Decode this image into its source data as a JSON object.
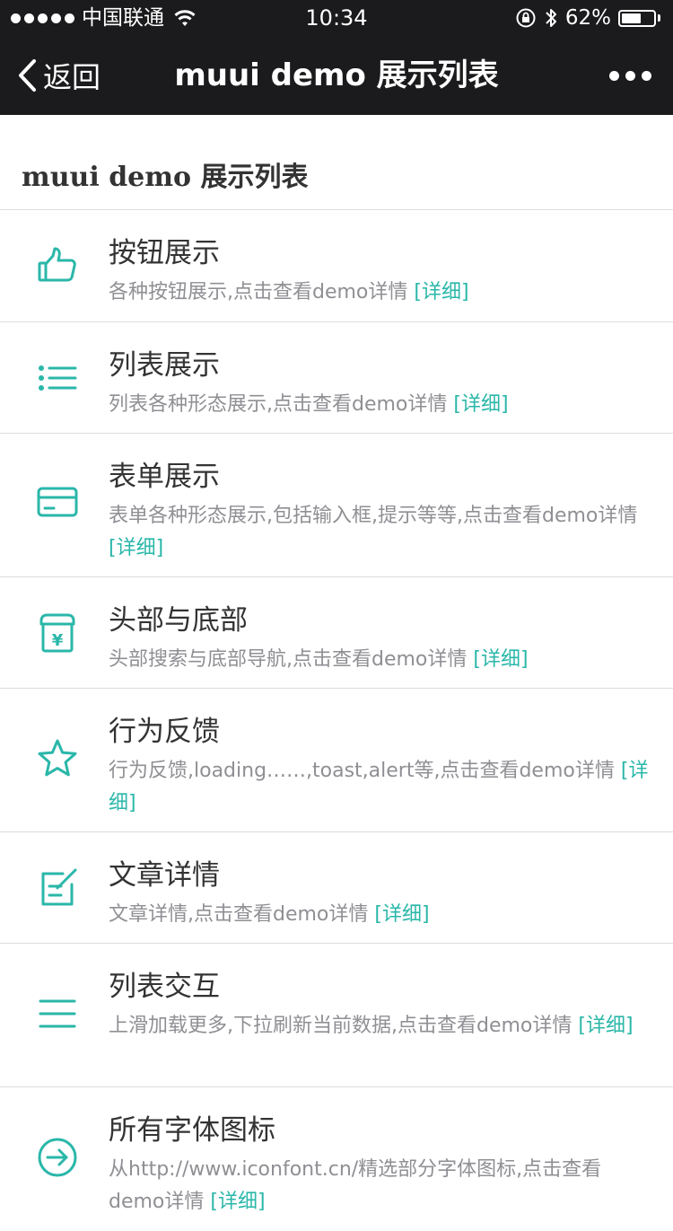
{
  "status_bar": {
    "carrier": "中国联通",
    "time": "10:34",
    "battery_percent": "62%",
    "battery_level": 0.62,
    "signal_bars": 5,
    "icons": [
      "signal-dots-icon",
      "wifi-icon",
      "rotation-lock-icon",
      "bluetooth-icon",
      "battery-icon"
    ]
  },
  "nav": {
    "back_label": "返回",
    "title": "muui demo 展示列表"
  },
  "section": {
    "title": "muui demo 展示列表"
  },
  "accent_color": "#2ab7a9",
  "items": [
    {
      "title": "按钮展示",
      "desc": "各种按钮展示,点击查看demo详情",
      "link": "[详细]",
      "icon": "thumbs-up-icon"
    },
    {
      "title": "列表展示",
      "desc": "列表各种形态展示,点击查看demo详情",
      "link": "[详细]",
      "icon": "bullet-list-icon"
    },
    {
      "title": "表单展示",
      "desc": "表单各种形态展示,包括输入框,提示等等,点击查看demo详情",
      "link": "[详细]",
      "icon": "form-card-icon"
    },
    {
      "title": "头部与底部",
      "desc": "头部搜索与底部导航,点击查看demo详情",
      "link": "[详细]",
      "icon": "yen-box-icon"
    },
    {
      "title": "行为反馈",
      "desc": "行为反馈,loading……,toast,alert等,点击查看demo详情",
      "link": "[详细]",
      "icon": "star-icon"
    },
    {
      "title": "文章详情",
      "desc": "文章详情,点击查看demo详情",
      "link": "[详细]",
      "icon": "edit-note-icon"
    },
    {
      "title": "列表交互",
      "desc": "上滑加载更多,下拉刷新当前数据,点击查看demo详情",
      "link": "[详细]",
      "icon": "menu-lines-icon"
    },
    {
      "title": "所有字体图标",
      "desc": "从http://www.iconfont.cn/精选部分字体图标,点击查看demo详情",
      "link": "[详细]",
      "icon": "arrow-circle-icon"
    }
  ]
}
